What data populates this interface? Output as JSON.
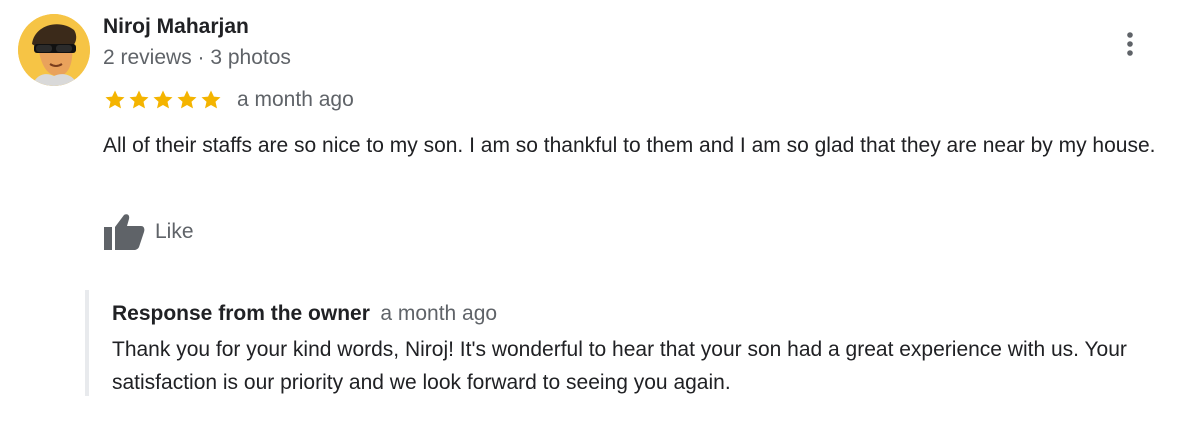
{
  "review": {
    "reviewer": {
      "name": "Niroj Maharjan",
      "meta": "2 reviews · 3 photos",
      "avatar": "cartoon-avatar-with-sunglasses"
    },
    "rating": 5,
    "rating_max": 5,
    "star_color": "#f4b400",
    "date": "a month ago",
    "text": "All of their staffs are so nice to my son. I am so thankful to them and I am so glad that they are near by my house.",
    "actions": {
      "like_label": "Like",
      "like_icon": "thumbs-up-icon",
      "more_icon": "more-vert-icon"
    }
  },
  "owner_response": {
    "title": "Response from the owner",
    "date": "a month ago",
    "text": "Thank you for your kind words, Niroj! It's wonderful to hear that your son had a great experience with us. Your satisfaction is our priority and we look forward to seeing you again."
  }
}
